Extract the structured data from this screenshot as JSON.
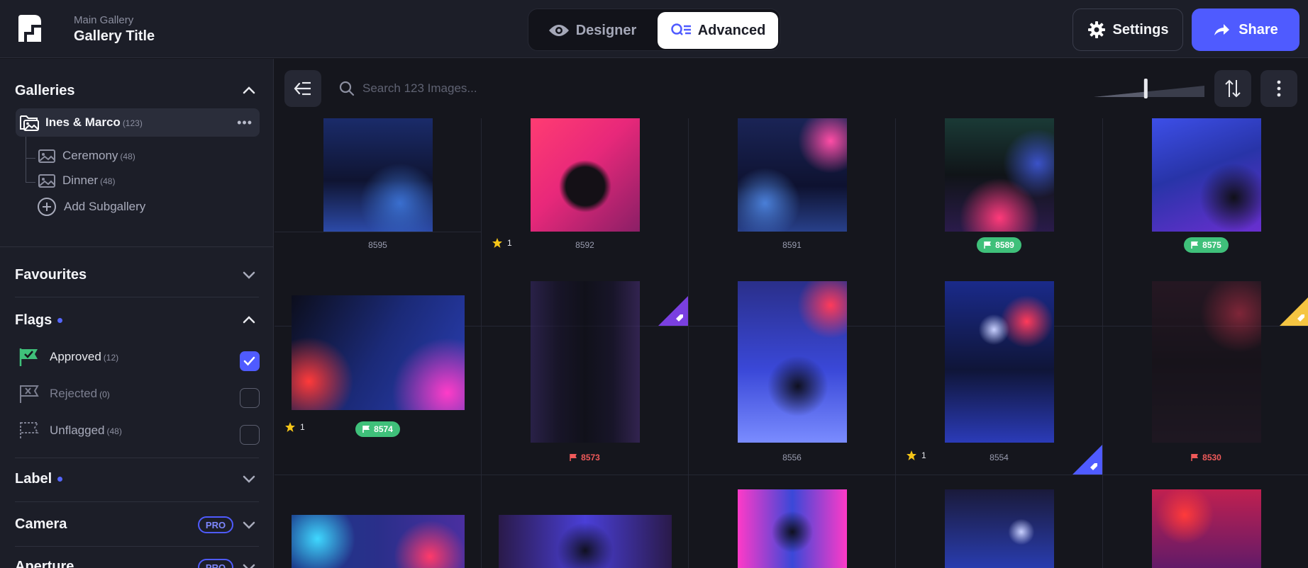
{
  "header": {
    "crumb": "Main Gallery",
    "title": "Gallery Title",
    "modes": [
      {
        "label": "Designer",
        "icon": "eye-icon",
        "active": false
      },
      {
        "label": "Advanced",
        "icon": "advanced-search-icon",
        "active": true
      }
    ],
    "settings_label": "Settings",
    "share_label": "Share",
    "colors": {
      "accent": "#4f5bff",
      "approved": "#3fc07a",
      "rejected": "#f05a5a",
      "star": "#f5c518"
    }
  },
  "sidebar": {
    "galleries": {
      "title": "Galleries",
      "main": {
        "name": "Ines & Marco",
        "count": "(123)"
      },
      "subs": [
        {
          "name": "Ceremony",
          "count": "(48)"
        },
        {
          "name": "Dinner",
          "count": "(48)"
        }
      ],
      "add_label": "Add Subgallery"
    },
    "favourites": {
      "title": "Favourites"
    },
    "flags": {
      "title": "Flags",
      "items": [
        {
          "label": "Approved",
          "count": "(12)",
          "checked": true
        },
        {
          "label": "Rejected",
          "count": "(0)",
          "checked": false
        },
        {
          "label": "Unflagged",
          "count": "(48)",
          "checked": false
        }
      ]
    },
    "label": {
      "title": "Label"
    },
    "camera": {
      "title": "Camera",
      "badge": "PRO"
    },
    "aperture": {
      "title": "Aperture",
      "badge": "PRO"
    }
  },
  "toolbar": {
    "search_placeholder": "Search 123 Images...",
    "thumbnail_size": 0.47
  },
  "images": [
    {
      "id": "8595",
      "flag": "",
      "stars": "",
      "tag": ""
    },
    {
      "id": "8592",
      "flag": "",
      "stars": "1",
      "tag": "purple"
    },
    {
      "id": "8591",
      "flag": "",
      "stars": "",
      "tag": ""
    },
    {
      "id": "8589",
      "flag": "approved",
      "stars": "",
      "tag": ""
    },
    {
      "id": "8575",
      "flag": "approved",
      "stars": "",
      "tag": "yellow"
    },
    {
      "id": "8574",
      "flag": "approved",
      "stars": "1",
      "tag": ""
    },
    {
      "id": "8573",
      "flag": "rejected",
      "stars": "",
      "tag": ""
    },
    {
      "id": "8556",
      "flag": "",
      "stars": "",
      "tag": ""
    },
    {
      "id": "8554",
      "flag": "",
      "stars": "1",
      "tag": "blue"
    },
    {
      "id": "8530",
      "flag": "rejected",
      "stars": "",
      "tag": ""
    }
  ]
}
